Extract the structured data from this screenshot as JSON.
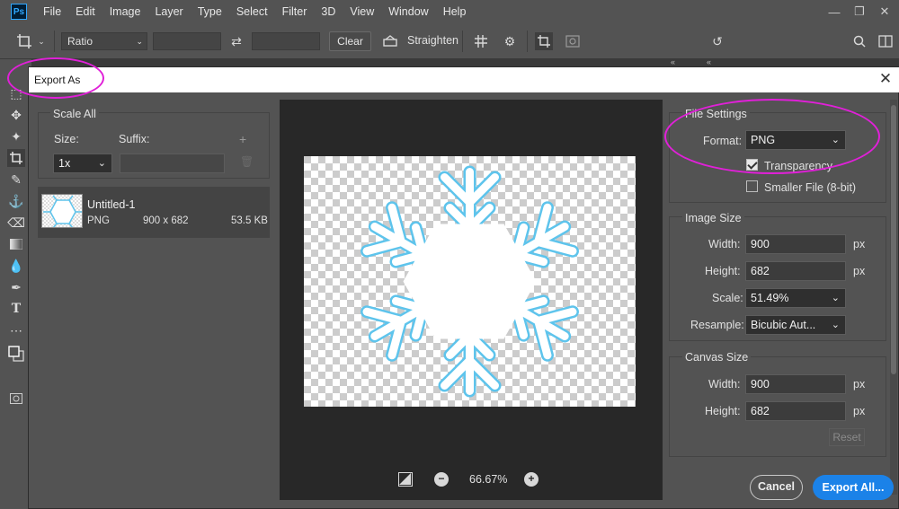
{
  "app": {
    "logo": "Ps"
  },
  "menu": [
    "File",
    "Edit",
    "Image",
    "Layer",
    "Type",
    "Select",
    "Filter",
    "3D",
    "View",
    "Window",
    "Help"
  ],
  "options_bar": {
    "ratio_label": "Ratio",
    "clear_label": "Clear",
    "straighten_label": "Straighten"
  },
  "dialog": {
    "title": "Export As",
    "scale_all": {
      "title": "Scale All",
      "size_label": "Size:",
      "suffix_label": "Suffix:",
      "size_value": "1x",
      "suffix_value": ""
    },
    "asset": {
      "name": "Untitled-1",
      "format": "PNG",
      "dimensions": "900 x 682",
      "filesize": "53.5 KB"
    },
    "preview": {
      "zoom": "66.67%"
    },
    "file_settings": {
      "title": "File Settings",
      "format_label": "Format:",
      "format_value": "PNG",
      "transparency_label": "Transparency",
      "transparency_checked": true,
      "smaller_file_label": "Smaller File (8-bit)",
      "smaller_file_checked": false
    },
    "image_size": {
      "title": "Image Size",
      "width_label": "Width:",
      "width_value": "900",
      "height_label": "Height:",
      "height_value": "682",
      "scale_label": "Scale:",
      "scale_value": "51.49%",
      "resample_label": "Resample:",
      "resample_value": "Bicubic Aut...",
      "unit": "px"
    },
    "canvas_size": {
      "title": "Canvas Size",
      "width_label": "Width:",
      "width_value": "900",
      "height_label": "Height:",
      "height_value": "682",
      "unit": "px",
      "reset_label": "Reset"
    },
    "buttons": {
      "cancel": "Cancel",
      "export": "Export All..."
    }
  },
  "colors": {
    "accent": "#1b82e8",
    "annotation": "#e020d8",
    "snowflake_stroke": "#5ec4ec"
  }
}
